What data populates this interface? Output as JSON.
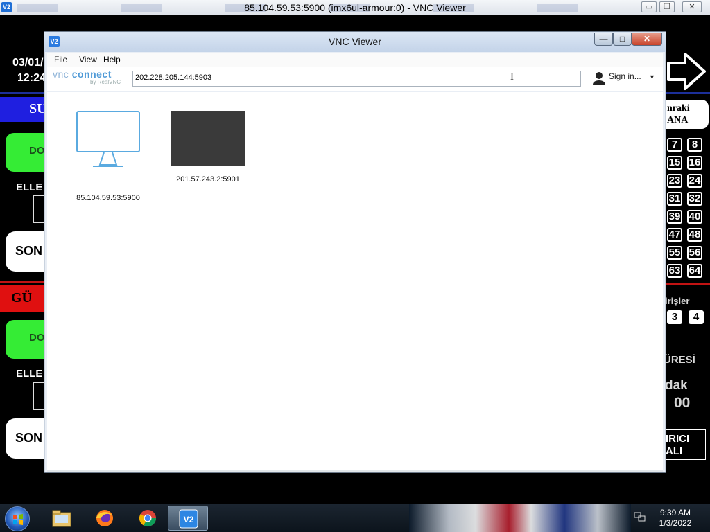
{
  "outer_window": {
    "title": "85.104.59.53:5900 (imx6ul-armour:0) - VNC Viewer",
    "icon": "vnc-icon",
    "buttons": {
      "minimize": "▭",
      "restore": "❐",
      "close": "✕"
    }
  },
  "remote_screen": {
    "left": {
      "date": "03/01/",
      "time": "12:24",
      "blue_banner": "SU",
      "red_banner": "GÜ",
      "green_btn_1": "DO",
      "green_btn_2": "DO",
      "label_1": "ELLE",
      "label_2": "ELLE",
      "white_btn_1": "SON",
      "white_btn_2": "SON"
    },
    "right": {
      "next_label_1": "nraki",
      "next_label_2": "ANA",
      "numbers": [
        "7",
        "8",
        "15",
        "16",
        "23",
        "24",
        "31",
        "32",
        "39",
        "40",
        "47",
        "48",
        "55",
        "56",
        "63",
        "64"
      ],
      "girisler_label": "irişler",
      "inputs": [
        "3",
        "4"
      ],
      "suresi_label": "ÜRESİ",
      "dak_label": "dak",
      "time_value": "00",
      "box_line1": "IRICI",
      "box_line2": "ALI"
    }
  },
  "vnc_window": {
    "title": "VNC Viewer",
    "icon": "vnc-icon",
    "menu": [
      "File",
      "View",
      "Help"
    ],
    "logo": {
      "vnc": "vnc",
      "connect": "connect",
      "by": "by RealVNC"
    },
    "address_value": "202.228.205.144:5903",
    "sign_in": "Sign in...",
    "connections": [
      {
        "label": "85.104.59.53:5900",
        "thumbnail": "monitor-icon"
      },
      {
        "label": "201.57.243.2:5901",
        "thumbnail": "dark-preview"
      }
    ]
  },
  "taskbar": {
    "items": [
      "start-orb",
      "file-explorer-icon",
      "firefox-icon",
      "chrome-icon",
      "vnc-viewer-icon"
    ],
    "clock_time": "9:39 AM",
    "clock_date": "1/3/2022"
  }
}
